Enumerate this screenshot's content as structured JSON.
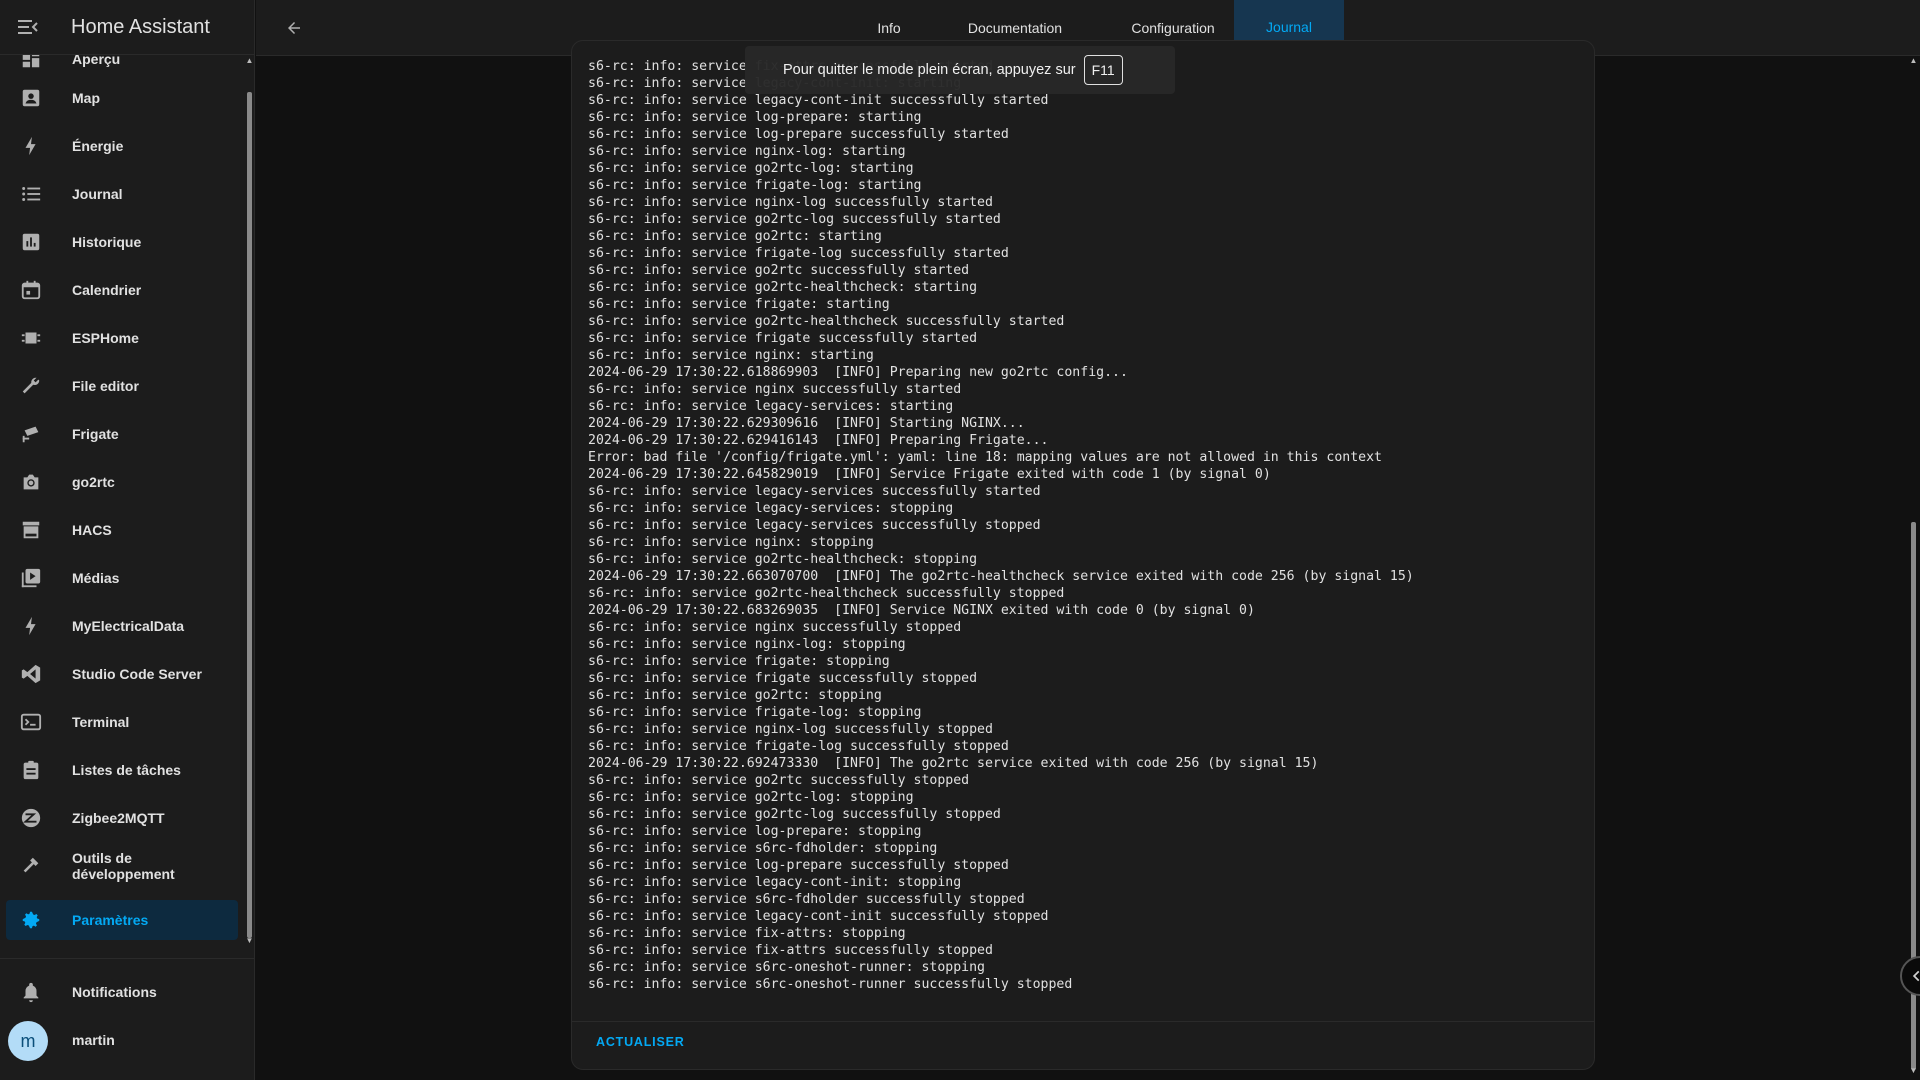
{
  "app": {
    "title": "Home Assistant"
  },
  "sidebar": {
    "items": [
      {
        "label": "Aperçu",
        "icon": "view-dashboard-icon",
        "active": false
      },
      {
        "label": "Map",
        "icon": "map-account-icon",
        "active": false
      },
      {
        "label": "Énergie",
        "icon": "lightning-bolt-icon",
        "active": false
      },
      {
        "label": "Journal",
        "icon": "format-list-bulleted-icon",
        "active": false
      },
      {
        "label": "Historique",
        "icon": "chart-box-icon",
        "active": false
      },
      {
        "label": "Calendrier",
        "icon": "calendar-icon",
        "active": false
      },
      {
        "label": "ESPHome",
        "icon": "chip-icon",
        "active": false
      },
      {
        "label": "File editor",
        "icon": "wrench-icon",
        "active": false
      },
      {
        "label": "Frigate",
        "icon": "cctv-icon",
        "active": false
      },
      {
        "label": "go2rtc",
        "icon": "camera-icon",
        "active": false
      },
      {
        "label": "HACS",
        "icon": "hacs-store-icon",
        "active": false
      },
      {
        "label": "Médias",
        "icon": "play-box-multiple-icon",
        "active": false
      },
      {
        "label": "MyElectricalData",
        "icon": "flash-icon",
        "active": false
      },
      {
        "label": "Studio Code Server",
        "icon": "vscode-icon",
        "active": false
      },
      {
        "label": "Terminal",
        "icon": "console-icon",
        "active": false
      },
      {
        "label": "Listes de tâches",
        "icon": "clipboard-list-icon",
        "active": false
      },
      {
        "label": "Zigbee2MQTT",
        "icon": "zigbee-icon",
        "active": false
      },
      {
        "label": "Outils de développement",
        "icon": "hammer-icon",
        "active": false
      },
      {
        "label": "Paramètres",
        "icon": "cog-icon",
        "active": true
      }
    ],
    "notifications_label": "Notifications",
    "user": {
      "name": "martin",
      "initial": "m"
    }
  },
  "tabs": [
    {
      "label": "Info",
      "active": false
    },
    {
      "label": "Documentation",
      "active": false
    },
    {
      "label": "Configuration",
      "active": false
    },
    {
      "label": "Journal",
      "active": true
    }
  ],
  "toast": {
    "text": "Pour quitter le mode plein écran, appuyez sur",
    "key": "F11"
  },
  "log": {
    "lines": [
      "s6-rc: info: service fix-attrs successfully started",
      "s6-rc: info: service legacy-cont-init: starting",
      "s6-rc: info: service legacy-cont-init successfully started",
      "s6-rc: info: service log-prepare: starting",
      "s6-rc: info: service log-prepare successfully started",
      "s6-rc: info: service nginx-log: starting",
      "s6-rc: info: service go2rtc-log: starting",
      "s6-rc: info: service frigate-log: starting",
      "s6-rc: info: service nginx-log successfully started",
      "s6-rc: info: service go2rtc-log successfully started",
      "s6-rc: info: service go2rtc: starting",
      "s6-rc: info: service frigate-log successfully started",
      "s6-rc: info: service go2rtc successfully started",
      "s6-rc: info: service go2rtc-healthcheck: starting",
      "s6-rc: info: service frigate: starting",
      "s6-rc: info: service go2rtc-healthcheck successfully started",
      "s6-rc: info: service frigate successfully started",
      "s6-rc: info: service nginx: starting",
      "2024-06-29 17:30:22.618869903  [INFO] Preparing new go2rtc config...",
      "s6-rc: info: service nginx successfully started",
      "s6-rc: info: service legacy-services: starting",
      "2024-06-29 17:30:22.629309616  [INFO] Starting NGINX...",
      "2024-06-29 17:30:22.629416143  [INFO] Preparing Frigate...",
      "Error: bad file '/config/frigate.yml': yaml: line 18: mapping values are not allowed in this context",
      "2024-06-29 17:30:22.645829019  [INFO] Service Frigate exited with code 1 (by signal 0)",
      "s6-rc: info: service legacy-services successfully started",
      "s6-rc: info: service legacy-services: stopping",
      "s6-rc: info: service legacy-services successfully stopped",
      "s6-rc: info: service nginx: stopping",
      "s6-rc: info: service go2rtc-healthcheck: stopping",
      "2024-06-29 17:30:22.663070700  [INFO] The go2rtc-healthcheck service exited with code 256 (by signal 15)",
      "s6-rc: info: service go2rtc-healthcheck successfully stopped",
      "2024-06-29 17:30:22.683269035  [INFO] Service NGINX exited with code 0 (by signal 0)",
      "s6-rc: info: service nginx successfully stopped",
      "s6-rc: info: service nginx-log: stopping",
      "s6-rc: info: service frigate: stopping",
      "s6-rc: info: service frigate successfully stopped",
      "s6-rc: info: service go2rtc: stopping",
      "s6-rc: info: service frigate-log: stopping",
      "s6-rc: info: service nginx-log successfully stopped",
      "s6-rc: info: service frigate-log successfully stopped",
      "2024-06-29 17:30:22.692473330  [INFO] The go2rtc service exited with code 256 (by signal 15)",
      "s6-rc: info: service go2rtc successfully stopped",
      "s6-rc: info: service go2rtc-log: stopping",
      "s6-rc: info: service go2rtc-log successfully stopped",
      "s6-rc: info: service log-prepare: stopping",
      "s6-rc: info: service s6rc-fdholder: stopping",
      "s6-rc: info: service log-prepare successfully stopped",
      "s6-rc: info: service legacy-cont-init: stopping",
      "s6-rc: info: service s6rc-fdholder successfully stopped",
      "s6-rc: info: service legacy-cont-init successfully stopped",
      "s6-rc: info: service fix-attrs: stopping",
      "s6-rc: info: service fix-attrs successfully stopped",
      "s6-rc: info: service s6rc-oneshot-runner: stopping",
      "s6-rc: info: service s6rc-oneshot-runner successfully stopped"
    ],
    "refresh_label": "ACTUALISER"
  },
  "colors": {
    "accent": "#03a9f4",
    "background": "#111111",
    "card": "#1c1c1c",
    "text": "#e1e1e1",
    "icon": "#b0b0b0"
  }
}
